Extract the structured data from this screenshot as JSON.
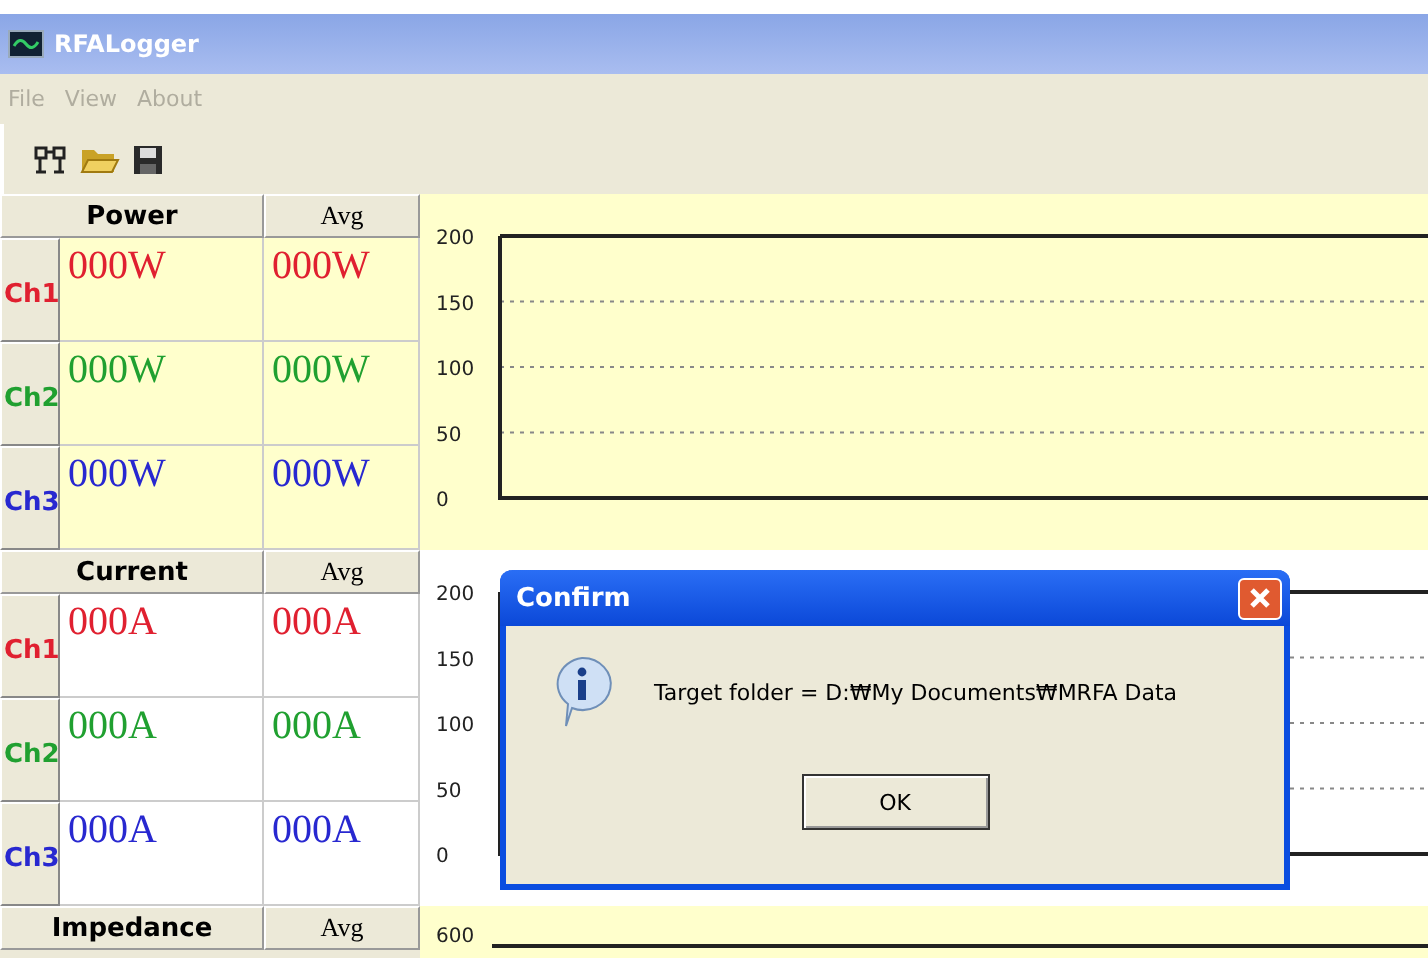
{
  "window": {
    "title": "RFALogger"
  },
  "menu": [
    {
      "label": "File",
      "disabled": true
    },
    {
      "label": "View",
      "disabled": true
    },
    {
      "label": "About",
      "disabled": true
    }
  ],
  "sections": [
    {
      "header": "Power",
      "avg_header": "Avg",
      "highlighted": true,
      "rows": [
        {
          "channel": "Ch1",
          "value": "000W",
          "avg": "000W",
          "color": "#e02030"
        },
        {
          "channel": "Ch2",
          "value": "000W",
          "avg": "000W",
          "color": "#20a030"
        },
        {
          "channel": "Ch3",
          "value": "000W",
          "avg": "000W",
          "color": "#2828d0"
        }
      ],
      "axis_labels": [
        "200",
        "150",
        "100",
        "50",
        "0"
      ]
    },
    {
      "header": "Current",
      "avg_header": "Avg",
      "highlighted": false,
      "rows": [
        {
          "channel": "Ch1",
          "value": "000A",
          "avg": "000A",
          "color": "#e02030"
        },
        {
          "channel": "Ch2",
          "value": "000A",
          "avg": "000A",
          "color": "#20a030"
        },
        {
          "channel": "Ch3",
          "value": "000A",
          "avg": "000A",
          "color": "#2828d0"
        }
      ],
      "axis_labels": [
        "200",
        "150",
        "100",
        "50",
        "0"
      ]
    },
    {
      "header": "Impedance",
      "avg_header": "Avg",
      "highlighted": true,
      "axis_labels": [
        "600"
      ]
    }
  ],
  "dialog": {
    "title": "Confirm",
    "message": "Target folder = D:₩My Documents₩MRFA Data",
    "button": "OK"
  }
}
